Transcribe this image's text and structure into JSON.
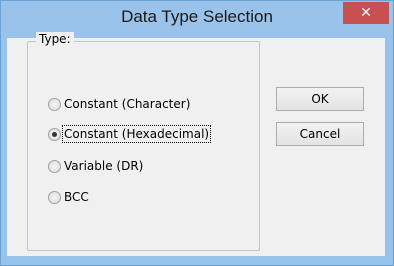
{
  "dialog": {
    "title": "Data Type Selection",
    "close_icon": "close-icon"
  },
  "group": {
    "label": "Type:",
    "options": [
      {
        "label": "Constant (Character)",
        "checked": false
      },
      {
        "label": "Constant (Hexadecimal)",
        "checked": true
      },
      {
        "label": "Variable (DR)",
        "checked": false
      },
      {
        "label": "BCC",
        "checked": false
      }
    ]
  },
  "buttons": {
    "ok_label": "OK",
    "cancel_label": "Cancel"
  },
  "colors": {
    "titlebar": "#99c3ea",
    "close_button": "#c75050",
    "client": "#f0f0f0"
  }
}
